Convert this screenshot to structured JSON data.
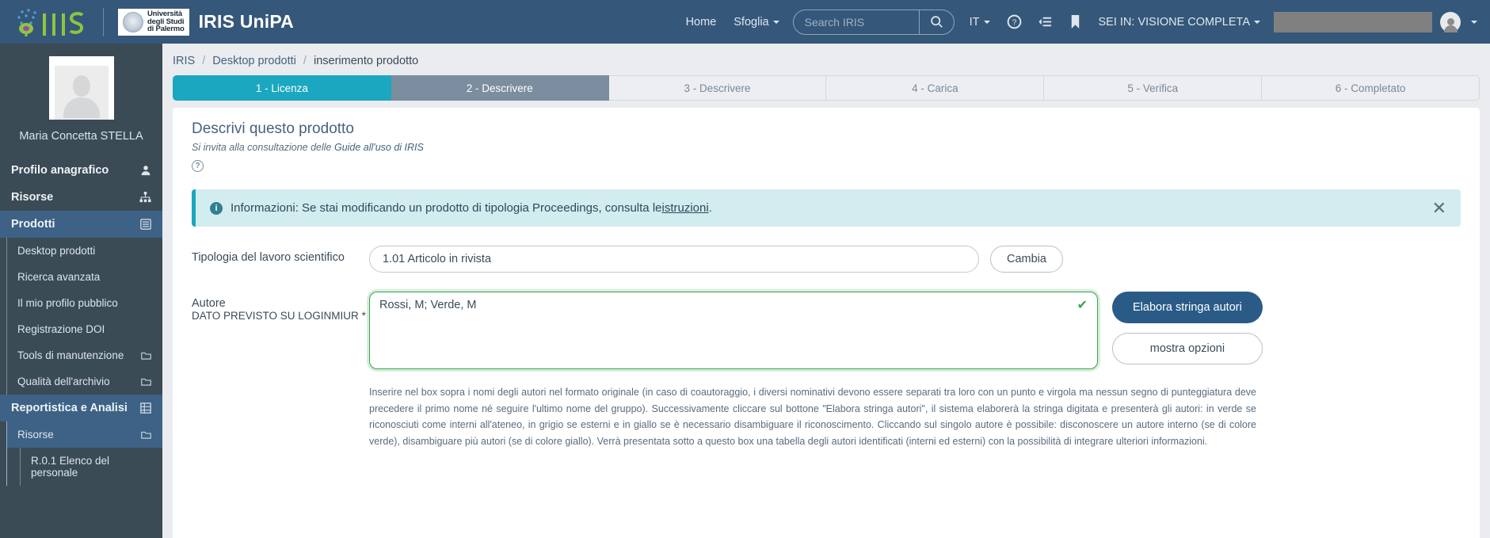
{
  "header": {
    "logo_text": "IRIS",
    "university_lines": [
      "Università",
      "degli Studi",
      "di Palermo"
    ],
    "brand_title": "IRIS UniPA",
    "nav": [
      {
        "label": "Home",
        "caret": false
      },
      {
        "label": "Sfoglia",
        "caret": true
      }
    ],
    "search": {
      "placeholder": "Search IRIS",
      "value": "",
      "icon": "search-icon"
    },
    "language": {
      "label": "IT",
      "caret": true
    },
    "icons": [
      "help-icon",
      "list-indent-icon",
      "bookmark-icon"
    ],
    "view_mode": {
      "label": "SEI IN: VISIONE COMPLETA",
      "caret": true
    },
    "user_name_redacted": "",
    "avatar": "user-avatar-icon"
  },
  "sidebar": {
    "user": {
      "name": "Maria Concetta  STELLA",
      "avatar": "user-photo-placeholder"
    },
    "groups": [
      {
        "label": "Profilo anagrafico",
        "icon": "person-icon",
        "active": false,
        "items": []
      },
      {
        "label": "Risorse",
        "icon": "sitemap-icon",
        "active": false,
        "items": []
      },
      {
        "label": "Prodotti",
        "icon": "list-icon",
        "active": true,
        "items": [
          {
            "label": "Desktop prodotti",
            "icon": ""
          },
          {
            "label": "Ricerca avanzata",
            "icon": ""
          },
          {
            "label": "Il mio profilo pubblico",
            "icon": ""
          },
          {
            "label": "Registrazione DOI",
            "icon": ""
          },
          {
            "label": "Tools di manutenzione",
            "icon": "folder-icon"
          },
          {
            "label": "Qualità dell'archivio",
            "icon": "folder-icon"
          }
        ]
      },
      {
        "label": "Reportistica e Analisi",
        "icon": "grid-icon",
        "active": true,
        "items": [
          {
            "label": "Risorse",
            "icon": "folder-icon",
            "selected": true
          },
          {
            "label": "R.0.1 Elenco del personale",
            "icon": ""
          }
        ]
      }
    ]
  },
  "main": {
    "breadcrumb": [
      "IRIS",
      "Desktop prodotti",
      "inserimento prodotto"
    ],
    "steps": [
      {
        "label": "1 - Licenza",
        "state": "done"
      },
      {
        "label": "2 - Descrivere",
        "state": "current"
      },
      {
        "label": "3 - Descrivere",
        "state": "todo"
      },
      {
        "label": "4 - Carica",
        "state": "todo"
      },
      {
        "label": "5 - Verifica",
        "state": "todo"
      },
      {
        "label": "6 - Completato",
        "state": "todo"
      }
    ],
    "page_title": "Descrivi questo prodotto",
    "subtitle_prefix": "Si invita alla consultazione delle ",
    "subtitle_link": "Guide all'uso di IRIS",
    "help_icon_label": "?",
    "alert": {
      "icon": "info-icon",
      "text_before": "Informazioni: Se stai modificando un prodotto di tipologia Proceedings, consulta le ",
      "link": "istruzioni",
      "text_after": ".",
      "close_label": "✕",
      "accent_color": "#1ba7bf",
      "background": "#d3ecef"
    },
    "fields": {
      "tipologia": {
        "label": "Tipologia del lavoro scientifico",
        "value": "1.01 Articolo in rivista",
        "button": "Cambia"
      },
      "autore": {
        "label": "Autore",
        "sublabel": "DATO PREVISTO SU LOGINMIUR",
        "required_mark": "*",
        "value": "Rossi, M; Verde, M",
        "valid_icon": "check-icon",
        "buttons": {
          "primary": "Elabora stringa autori",
          "secondary": "mostra opzioni"
        },
        "hint": "Inserire nel box sopra i nomi degli autori nel formato originale (in caso di coautoraggio, i diversi nominativi devono essere separati tra loro con un punto e virgola ma nessun segno di punteggiatura deve precedere il primo nome né seguire l'ultimo nome del gruppo). Successivamente cliccare sul bottone \"Elabora stringa autori\", il sistema elaborerà la stringa digitata e presenterà gli autori: in verde se riconosciuti come interni all'ateneo, in grigio se esterni e in giallo se è necessario disambiguare il riconoscimento. Cliccando sul singolo autore è possibile: disconoscere un autore interno (se di colore verde), disambiguare più autori (se di colore giallo). Verrà presentata sotto a questo box una tabella degli autori identificati (interni ed esterni) con la possibilità di integrare ulteriori informazioni."
      }
    }
  },
  "colors": {
    "topbar": "#35577a",
    "sidebar": "#3b4b55",
    "sidebar_active": "#3d6286",
    "step_done": "#1ba7bf",
    "step_current": "#7b8d9e",
    "primary_button": "#2a5b87",
    "valid_green": "#3aa34a"
  }
}
